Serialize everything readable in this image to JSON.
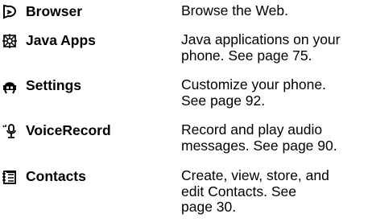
{
  "menu": {
    "items": [
      {
        "icon": "browser-icon",
        "name": "Browser",
        "description": "Browse the Web."
      },
      {
        "icon": "java-apps-icon",
        "name": "Java Apps",
        "description": "Java applications on your\nphone. See page 75."
      },
      {
        "icon": "settings-icon",
        "name": "Settings",
        "description": "Customize your phone.\nSee page 92."
      },
      {
        "icon": "voice-record-icon",
        "name": "VoiceRecord",
        "description": "Record and play audio\nmessages. See page 90."
      },
      {
        "icon": "contacts-icon",
        "name": "Contacts",
        "description": "Create, view, store, and\nedit Contacts. See\npage 30."
      }
    ]
  }
}
